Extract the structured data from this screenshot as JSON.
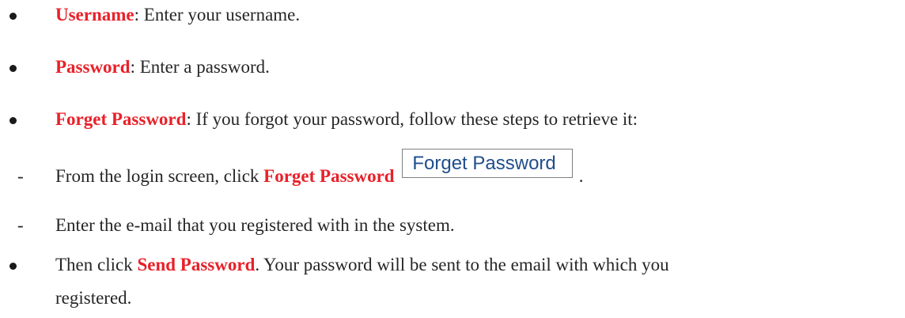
{
  "items": [
    {
      "term": "Username",
      "text": ": Enter your username."
    },
    {
      "term": "Password",
      "text": ": Enter a password."
    },
    {
      "term": "Forget Password",
      "text": ": If you forgot your password, follow these steps to retrieve it:"
    }
  ],
  "steps": {
    "step1": {
      "prefix": "From the login screen, click ",
      "term": "Forget Password",
      "button_label": "Forget Password",
      "suffix": "."
    },
    "step2": {
      "text": "Enter the e-mail that you registered with in the system."
    },
    "dash": "-"
  },
  "final": {
    "prefix": "Then click ",
    "term": "Send Password",
    "text": ". Your password will be sent to the email with which you",
    "continuation": "registered."
  }
}
